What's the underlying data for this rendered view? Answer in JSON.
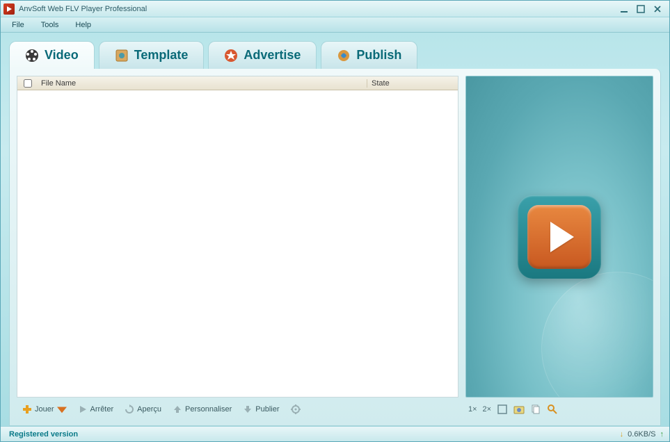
{
  "window": {
    "title": "AnvSoft Web FLV Player Professional"
  },
  "menu": {
    "file": "File",
    "tools": "Tools",
    "help": "Help"
  },
  "tabs": [
    {
      "id": "video",
      "label": "Video",
      "active": true
    },
    {
      "id": "template",
      "label": "Template",
      "active": false
    },
    {
      "id": "advertise",
      "label": "Advertise",
      "active": false
    },
    {
      "id": "publish",
      "label": "Publish",
      "active": false
    }
  ],
  "list": {
    "columns": {
      "filename": "File Name",
      "state": "State"
    },
    "rows": []
  },
  "toolbar": {
    "jouer": "Jouer",
    "arreter": "Arrêter",
    "apercu": "Aperçu",
    "personnaliser": "Personnaliser",
    "publier": "Publier"
  },
  "preview_toolbar": {
    "zoom1": "1×",
    "zoom2": "2×"
  },
  "status": {
    "left": "Registered version",
    "speed": "0.6KB/S"
  }
}
